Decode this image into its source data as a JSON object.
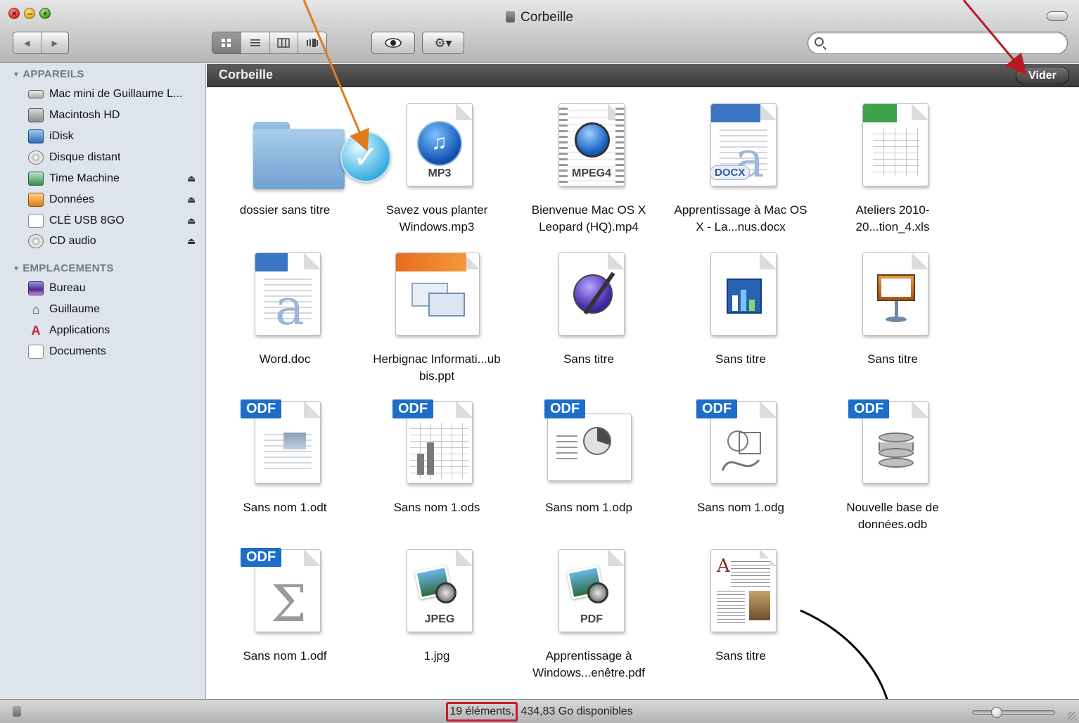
{
  "window": {
    "title": "Corbeille"
  },
  "toolbar": {
    "back_glyph": "◀",
    "forward_glyph": "▶",
    "view_modes": [
      "icons",
      "list",
      "columns",
      "coverflow"
    ],
    "active_view": "icons",
    "quicklook_glyph": "👁",
    "action_glyph": "⚙▾",
    "search_placeholder": "",
    "search_value": ""
  },
  "sidebar": {
    "devices_header": "APPAREILS",
    "devices": [
      {
        "label": "Mac mini de Guillaume L...",
        "icon": "mac-mini-icon",
        "eject": false
      },
      {
        "label": "Macintosh HD",
        "icon": "hard-drive-icon",
        "eject": false
      },
      {
        "label": "iDisk",
        "icon": "idisk-icon",
        "eject": false
      },
      {
        "label": "Disque distant",
        "icon": "remote-disc-icon",
        "eject": false
      },
      {
        "label": "Time Machine",
        "icon": "time-machine-icon",
        "eject": true
      },
      {
        "label": "Données",
        "icon": "drive-icon",
        "eject": true
      },
      {
        "label": "CLÉ USB 8GO",
        "icon": "usb-drive-icon",
        "eject": true
      },
      {
        "label": "CD audio",
        "icon": "cd-icon",
        "eject": true
      }
    ],
    "places_header": "EMPLACEMENTS",
    "places": [
      {
        "label": "Bureau",
        "icon": "desktop-icon"
      },
      {
        "label": "Guillaume",
        "icon": "home-icon"
      },
      {
        "label": "Applications",
        "icon": "applications-icon"
      },
      {
        "label": "Documents",
        "icon": "documents-icon"
      }
    ],
    "eject_glyph": "⏏"
  },
  "pathbar": {
    "label": "Corbeille",
    "empty_button": "Vider"
  },
  "files": [
    {
      "name": "dossier sans titre",
      "kind": "folder"
    },
    {
      "name": "Savez vous planter Windows.mp3",
      "kind": "mp3",
      "tag": "MP3",
      "selected_check": true
    },
    {
      "name": "Bienvenue Mac OS X Leopard (HQ).mp4",
      "kind": "mp4",
      "tag": "MPEG4"
    },
    {
      "name": "Apprentissage à Mac OS X - La...nus.docx",
      "kind": "docx",
      "tag": "DOCX"
    },
    {
      "name": "Ateliers 2010-20...tion_4.xls",
      "kind": "xls"
    },
    {
      "name": "Word.doc",
      "kind": "doc"
    },
    {
      "name": "Herbignac Informati...ub bis.ppt",
      "kind": "ppt"
    },
    {
      "name": "Sans titre",
      "kind": "pages-doc"
    },
    {
      "name": "Sans titre",
      "kind": "numbers"
    },
    {
      "name": "Sans titre",
      "kind": "keynote"
    },
    {
      "name": "Sans nom 1.odt",
      "kind": "odt",
      "tag": "ODF"
    },
    {
      "name": "Sans nom 1.ods",
      "kind": "ods",
      "tag": "ODF"
    },
    {
      "name": "Sans nom 1.odp",
      "kind": "odp",
      "tag": "ODF"
    },
    {
      "name": "Sans nom 1.odg",
      "kind": "odg",
      "tag": "ODF"
    },
    {
      "name": "Nouvelle base de données.odb",
      "kind": "odb",
      "tag": "ODF"
    },
    {
      "name": "Sans nom 1.odf",
      "kind": "odf",
      "tag": "ODF"
    },
    {
      "name": "1.jpg",
      "kind": "jpg",
      "tag": "JPEG"
    },
    {
      "name": "Apprentissage à Windows...enêtre.pdf",
      "kind": "pdf",
      "tag": "PDF"
    },
    {
      "name": "Sans titre",
      "kind": "pages"
    }
  ],
  "statusbar": {
    "count": "19 éléments,",
    "space": " 434,83 Go disponibles"
  },
  "colors": {
    "annotation_orange": "#e07a1f",
    "annotation_red": "#b51b25",
    "annotation_black": "#000000",
    "odf_blue": "#1d6ec8"
  }
}
